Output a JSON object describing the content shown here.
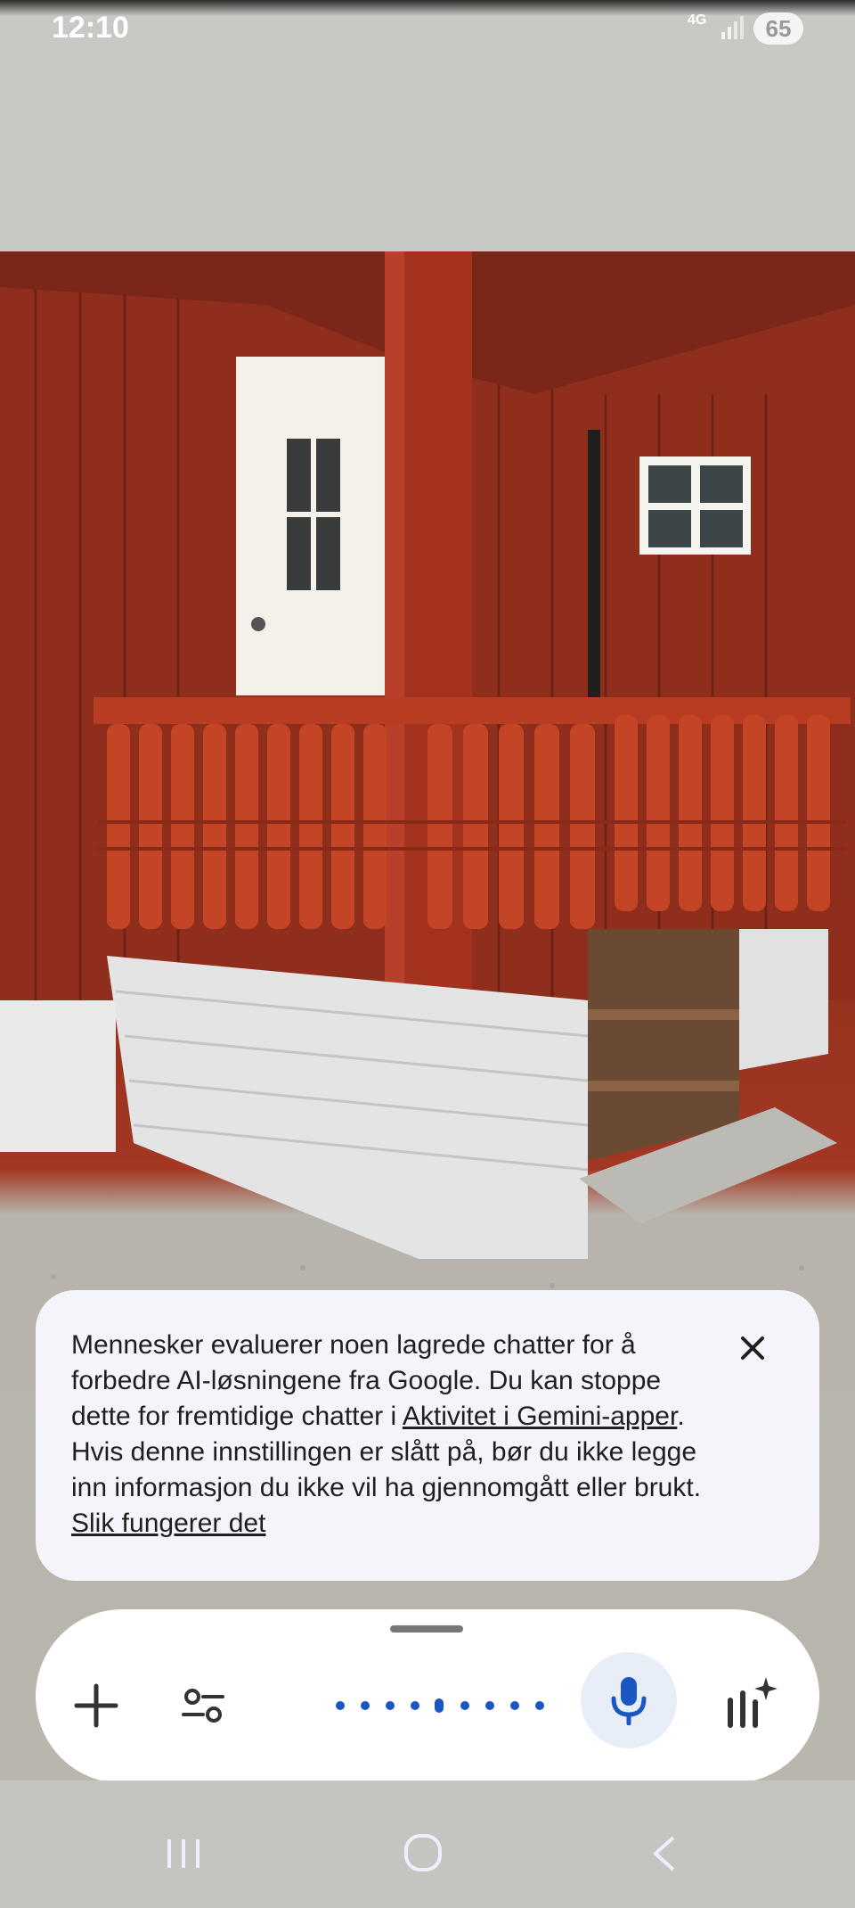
{
  "status_bar": {
    "time": "12:10",
    "network": "4G",
    "battery": "65"
  },
  "photo": {
    "subject": "red wooden house porch with turned balusters and white steps base",
    "icon": "photo-image"
  },
  "notice": {
    "text_before": "Mennesker evaluerer noen lagrede chatter for å forbedre AI-løsningene fra Google. Du kan stoppe dette for fremtidige chatter i ",
    "link_activity": "Aktivitet i Gemini-apper",
    "text_middle": ". Hvis denne innstillingen er slått på, bør du ikke legge inn informasjon du ikke vil ha gjennomgått eller brukt. ",
    "link_how": "Slik fungerer det",
    "close_icon": "close-icon"
  },
  "input_bar": {
    "add_icon": "plus-icon",
    "tools_icon": "tune-icon",
    "mic_icon": "microphone-icon",
    "live_icon": "live-sparkle-icon",
    "accent_color": "#1a56c4",
    "mic_background": "#e8eef8"
  },
  "nav_bar": {
    "recents_icon": "recents-icon",
    "home_icon": "home-icon",
    "back_icon": "back-icon"
  }
}
